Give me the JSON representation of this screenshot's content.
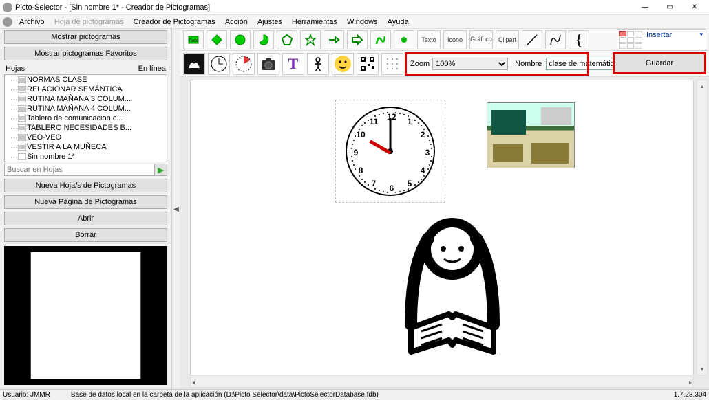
{
  "window": {
    "title": "Picto-Selector - [Sin nombre 1* - Creador de Pictogramas]"
  },
  "menu": {
    "archivo": "Archivo",
    "hoja": "Hoja de pictogramas",
    "creador": "Creador de Pictogramas",
    "accion": "Acción",
    "ajustes": "Ajustes",
    "herramientas": "Herramientas",
    "windows": "Windows",
    "ayuda": "Ayuda"
  },
  "left": {
    "mostrar": "Mostrar pictogramas",
    "mostrar_fav": "Mostrar pictogramas Favoritos",
    "hojas": "Hojas",
    "en_linea": "En línea",
    "search_placeholder": "Buscar en Hojas",
    "nueva_hojas": "Nueva Hoja/s de Pictogramas",
    "nueva_pagina": "Nueva Página de Pictogramas",
    "abrir": "Abrir",
    "borrar": "Borrar",
    "tree": [
      "NORMAS CLASE",
      "RELACIONAR SEMÁNTICA",
      "RUTINA MAÑANA 3 COLUM...",
      "RUTINA MAÑANA 4 COLUM...",
      "Tablero de comunicacion c...",
      "TABLERO NECESIDADES B...",
      "VEO-VEO",
      "VESTIR A LA MUÑECA",
      "Sin nombre 1*"
    ]
  },
  "toolbar": {
    "texto": "Texto",
    "icono": "Icono",
    "grafico": "Gráfi co",
    "clipart": "Clipart"
  },
  "insert": {
    "label": "Insertar"
  },
  "zoom": {
    "label": "Zoom",
    "value": "100%"
  },
  "name": {
    "label": "Nombre",
    "value": "clase de matemáticas"
  },
  "save": {
    "label": "Guardar"
  },
  "status": {
    "user": "Usuario: JMMR",
    "db": "Base de datos local en la carpeta de la aplicación (D:\\Picto Selector\\data\\PictoSelectorDatabase.fdb)",
    "version": "1.7.28.304"
  }
}
